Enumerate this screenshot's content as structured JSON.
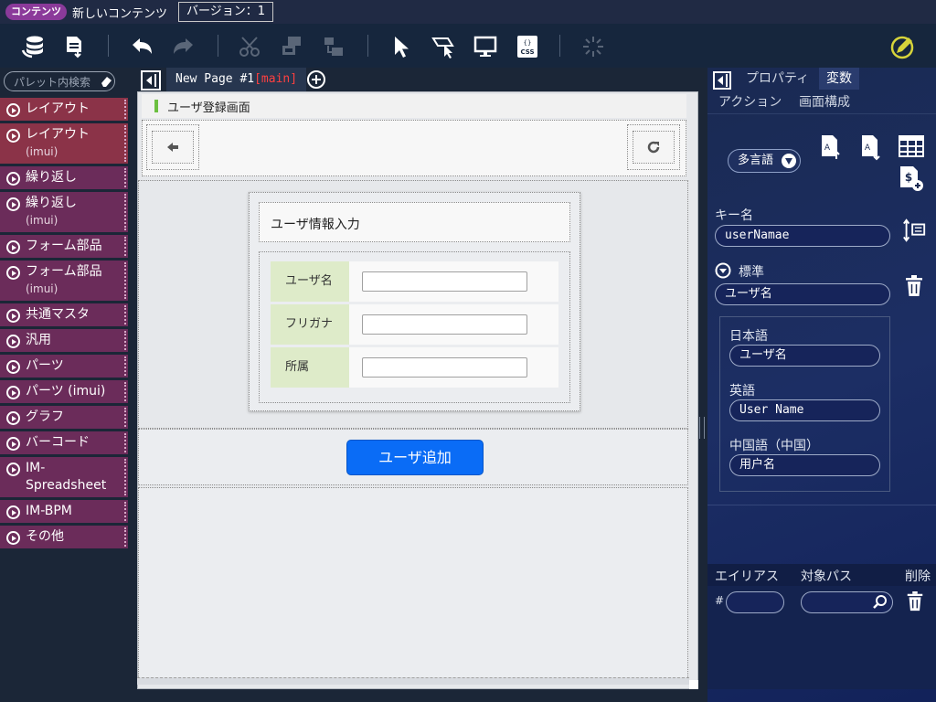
{
  "topbar": {
    "badge": "コンテンツ",
    "content_title": "新しいコンテンツ",
    "version_label": "バージョン：1"
  },
  "toolbar": {
    "icons": [
      "database-icon",
      "export-document-icon",
      "undo-icon",
      "redo-icon",
      "cut-icon",
      "copy-icon",
      "paste-icon",
      "select-pointer-icon",
      "area-select-icon",
      "preview-monitor-icon",
      "css-file-icon",
      "loading-spinner-icon",
      "edit-pen-icon"
    ]
  },
  "palette": {
    "search_placeholder": "パレット内検索",
    "items": [
      {
        "label": "レイアウト",
        "sub": ""
      },
      {
        "label": "レイアウト",
        "sub": "(imui)"
      },
      {
        "label": "繰り返し",
        "sub": ""
      },
      {
        "label": "繰り返し",
        "sub": "(imui)"
      },
      {
        "label": "フォーム部品",
        "sub": ""
      },
      {
        "label": "フォーム部品",
        "sub": "(imui)"
      },
      {
        "label": "共通マスタ",
        "sub": ""
      },
      {
        "label": "汎用",
        "sub": ""
      },
      {
        "label": "パーツ",
        "sub": ""
      },
      {
        "label": "パーツ (imui)",
        "sub": ""
      },
      {
        "label": "グラフ",
        "sub": ""
      },
      {
        "label": "バーコード",
        "sub": ""
      },
      {
        "label": "IM-Spreadsheet",
        "sub": ""
      },
      {
        "label": "IM-BPM",
        "sub": ""
      },
      {
        "label": "その他",
        "sub": ""
      }
    ]
  },
  "tabs": {
    "page_name": "New Page #1",
    "branch": "[main]"
  },
  "canvas": {
    "screen_title": "ユーザ登録画面",
    "form_title": "ユーザ情報入力",
    "fields": [
      {
        "label": "ユーザ名",
        "value": ""
      },
      {
        "label": "フリガナ",
        "value": ""
      },
      {
        "label": "所属",
        "value": ""
      }
    ],
    "add_button": "ユーザ追加"
  },
  "rpanel": {
    "tabs": [
      "プロパティ",
      "変数",
      "アクション",
      "画面構成"
    ],
    "active_tab": "変数",
    "lang_button": "多言語",
    "key_label": "キー名",
    "key_value": "userNamae",
    "standard_label": "標準",
    "standard_value": "ユーザ名",
    "ja_label": "日本語",
    "ja_value": "ユーザ名",
    "en_label": "英語",
    "en_value": "User Name",
    "zh_label": "中国語（中国）",
    "zh_value": "用户名",
    "alias_header": "エイリアス",
    "target_path_header": "対象パス",
    "delete_header": "削除",
    "alias_prefix": "#"
  },
  "colors": {
    "primary_button": "#0a6cf6",
    "palette_item": "#6b2c5a",
    "palette_item_active": "#8b3348",
    "label_cell": "#deebc9",
    "badge": "#8b3a9a"
  }
}
